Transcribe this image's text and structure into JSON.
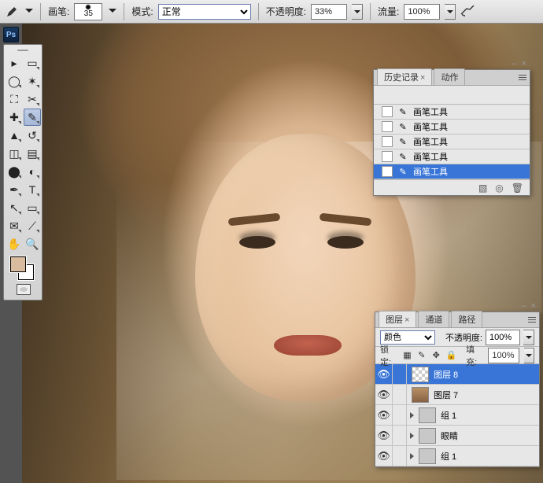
{
  "options": {
    "tool_label": "画笔:",
    "brush_size": "35",
    "mode_label": "模式:",
    "mode_value": "正常",
    "opacity_label": "不透明度:",
    "opacity_value": "33%",
    "flow_label": "流量:",
    "flow_value": "100%"
  },
  "app": {
    "logo_text": "Ps"
  },
  "history_panel": {
    "tabs": [
      "历史记录",
      "动作"
    ],
    "active_tab": 0,
    "items": [
      {
        "label": "画笔工具",
        "active": false
      },
      {
        "label": "画笔工具",
        "active": false
      },
      {
        "label": "画笔工具",
        "active": false
      },
      {
        "label": "画笔工具",
        "active": false
      },
      {
        "label": "画笔工具",
        "active": true
      }
    ]
  },
  "layers_panel": {
    "tabs": [
      "图层",
      "通道",
      "路径"
    ],
    "active_tab": 0,
    "blend_label": "颜色",
    "opacity_label": "不透明度:",
    "opacity_value": "100%",
    "lock_label": "锁定:",
    "fill_label": "填充:",
    "fill_value": "100%",
    "layers": [
      {
        "name": "图层 8",
        "kind": "pixel-checker",
        "visible": true,
        "active": true
      },
      {
        "name": "图层 7",
        "kind": "pixel-photo",
        "visible": true,
        "active": false
      },
      {
        "name": "组 1",
        "kind": "group",
        "visible": true,
        "active": false
      },
      {
        "name": "眼睛",
        "kind": "group",
        "visible": true,
        "active": false
      },
      {
        "name": "组 1",
        "kind": "group",
        "visible": true,
        "active": false
      }
    ]
  },
  "swatch": {
    "fg": "#d9bca0",
    "bg": "#ffffff"
  }
}
